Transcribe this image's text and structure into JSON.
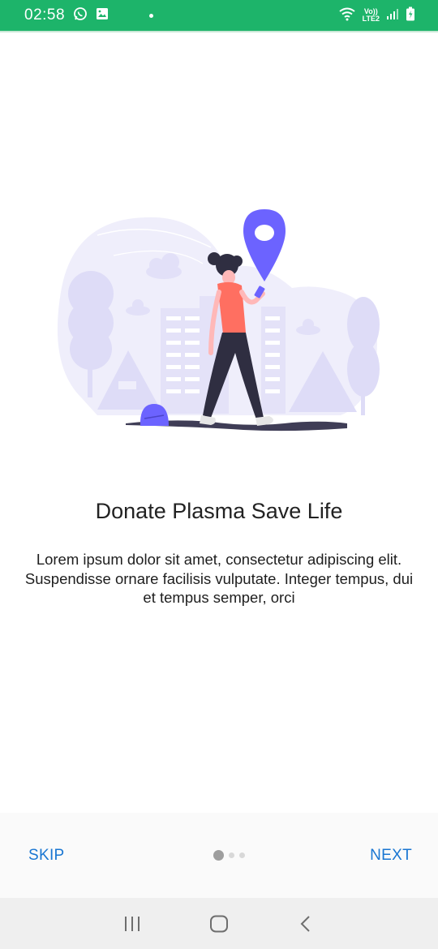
{
  "status_bar": {
    "time": "02:58",
    "network_top": "Vo))",
    "network_bottom": "LTE2",
    "color": "#1db46a"
  },
  "onboarding": {
    "title": "Donate Plasma Save Life",
    "description": "Lorem ipsum dolor sit amet, consectetur adipiscing elit. Suspendisse ornare facilisis vulputate. Integer tempus, dui et tempus semper, orci",
    "illustration": "woman-walking-with-location-pin",
    "accent_color": "#6c63ff"
  },
  "footer": {
    "skip_label": "SKIP",
    "next_label": "NEXT",
    "page_count": 3,
    "current_page": 1,
    "link_color": "#1976d2"
  },
  "system_nav": {
    "recents_icon": "recents-icon",
    "home_icon": "home-icon",
    "back_icon": "back-icon"
  }
}
